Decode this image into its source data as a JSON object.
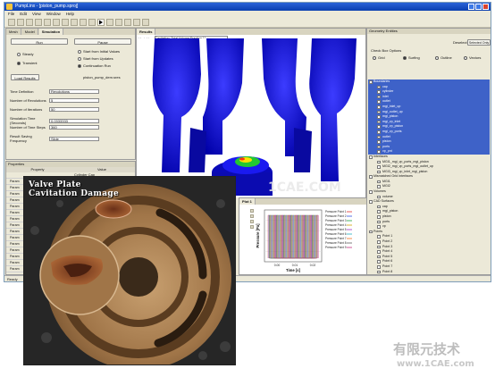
{
  "window": {
    "title": "PumpLinx - [piston_pump.sproj]",
    "menu": [
      "File",
      "Edit",
      "View",
      "Window",
      "Help"
    ]
  },
  "sim_panel": {
    "tabs": [
      "Mesh",
      "Model",
      "Simulation"
    ],
    "run_label": "Run",
    "pause_label": "Pause",
    "start_modes": [
      "Start from Initial Values",
      "Start from Updates",
      "Continuation Run"
    ],
    "solver_modes": [
      "Steady",
      "Transient"
    ],
    "load_button": "Load Results",
    "load_value": "piston_pump_dem.sres",
    "params": [
      {
        "label": "Time Definition",
        "value": "Revolutions"
      },
      {
        "label": "Number of Revolutions",
        "value": "5"
      },
      {
        "label": "Number of Iterations",
        "value": "50"
      },
      {
        "label": "Simulation Time (Seconds)",
        "value": "0.0333333"
      },
      {
        "label": "Number of Time Steps",
        "value": "360"
      },
      {
        "label": "Result Saving Frequency",
        "value": "Slide"
      }
    ]
  },
  "properties": {
    "title": "Properties",
    "columns": [
      "Property",
      "Value"
    ],
    "first_value": "Cylinder Cap",
    "row_labels": [
      "Param",
      "Param",
      "Param",
      "Param",
      "Param",
      "Param",
      "Param",
      "Param",
      "Param",
      "Param",
      "Param",
      "Param",
      "Param",
      "Param",
      "Param"
    ]
  },
  "status": {
    "text": "Ready"
  },
  "results": {
    "tab": "Results",
    "variable_label": "Variable:",
    "variable_value": "Cavitation: Total Volume Fraction [-]",
    "display_opts": [
      "Surface",
      "Grid",
      "Outline",
      "Vectors"
    ],
    "view_opts": [
      "Node Based View",
      "Cell Based View"
    ],
    "smooth_label": "Smooth Color Map"
  },
  "plot": {
    "tab": "Plot 1",
    "ylabel": "Pressure [Pa]",
    "xlabel": "Time [s]",
    "xticks": [
      "0.00",
      "0.01",
      "0.02"
    ],
    "legend": [
      "Pressure Point 1",
      "Pressure Point 2",
      "Pressure Point 3",
      "Pressure Point 4",
      "Pressure Point 5",
      "Pressure Point 6",
      "Pressure Point 7",
      "Pressure Point 8",
      "Pressure Point 9"
    ]
  },
  "geometry_entities": {
    "title": "Geometry Entities",
    "deselect_label": "Deselect",
    "selected_btn": "Selected Only",
    "check_label": "Check Box Options",
    "filter_opts": [
      "Grid",
      "Surfing",
      "Outline",
      "Vectors"
    ],
    "tree": [
      {
        "text": "Boundaries",
        "group": true,
        "sel": true
      },
      {
        "text": "cap",
        "sel": true
      },
      {
        "text": "cylinder",
        "sel": true
      },
      {
        "text": "inlet",
        "sel": true
      },
      {
        "text": "outlet",
        "sel": true
      },
      {
        "text": "mgi_inlet_up",
        "sel": true
      },
      {
        "text": "mgi_outlet_up",
        "sel": true
      },
      {
        "text": "mgi_piston",
        "sel": true
      },
      {
        "text": "mgi_vp_inlet",
        "sel": true
      },
      {
        "text": "mgi_vp_piston",
        "sel": true
      },
      {
        "text": "mgi_vp_ports",
        "sel": true
      },
      {
        "text": "outlet",
        "sel": true
      },
      {
        "text": "piston",
        "sel": true
      },
      {
        "text": "ports",
        "sel": true
      },
      {
        "text": "vp_pnt",
        "sel": true
      },
      {
        "text": "Interfaces",
        "group": true
      },
      {
        "text": "MGI1_mgi_vp_ports_mgi_piston"
      },
      {
        "text": "MGI2_mgi_vp_ports_mgi_outlet_up"
      },
      {
        "text": "MGI3_mgi_vp_inlet_mgi_piston"
      },
      {
        "text": "Mismatched Grid Interfaces",
        "group": true
      },
      {
        "text": "MGI1"
      },
      {
        "text": "MGI2"
      },
      {
        "text": "Volumes",
        "group": true
      },
      {
        "text": "volume"
      },
      {
        "text": "CAD Surfaces",
        "group": true
      },
      {
        "text": "cap"
      },
      {
        "text": "mgi_piston"
      },
      {
        "text": "piston"
      },
      {
        "text": "ports"
      },
      {
        "text": "vp"
      },
      {
        "text": "Points",
        "group": true
      },
      {
        "text": "Point 1"
      },
      {
        "text": "Point 2"
      },
      {
        "text": "Point 3"
      },
      {
        "text": "Point 4"
      },
      {
        "text": "Point 5"
      },
      {
        "text": "Point 6"
      },
      {
        "text": "Point 7"
      },
      {
        "text": "Point 8"
      },
      {
        "text": "Point 9"
      }
    ]
  },
  "photo": {
    "title_line1": "Valve Plate",
    "title_line2": "Cavitation Damage"
  },
  "watermark": {
    "center": "1CAE.COM",
    "cn_text": "有限元技术",
    "site": "www.1CAE.com"
  },
  "colors": {
    "mesh_blue": "#1010e0",
    "selection": "#3e62c8",
    "cavitation_green": "#22c832"
  }
}
